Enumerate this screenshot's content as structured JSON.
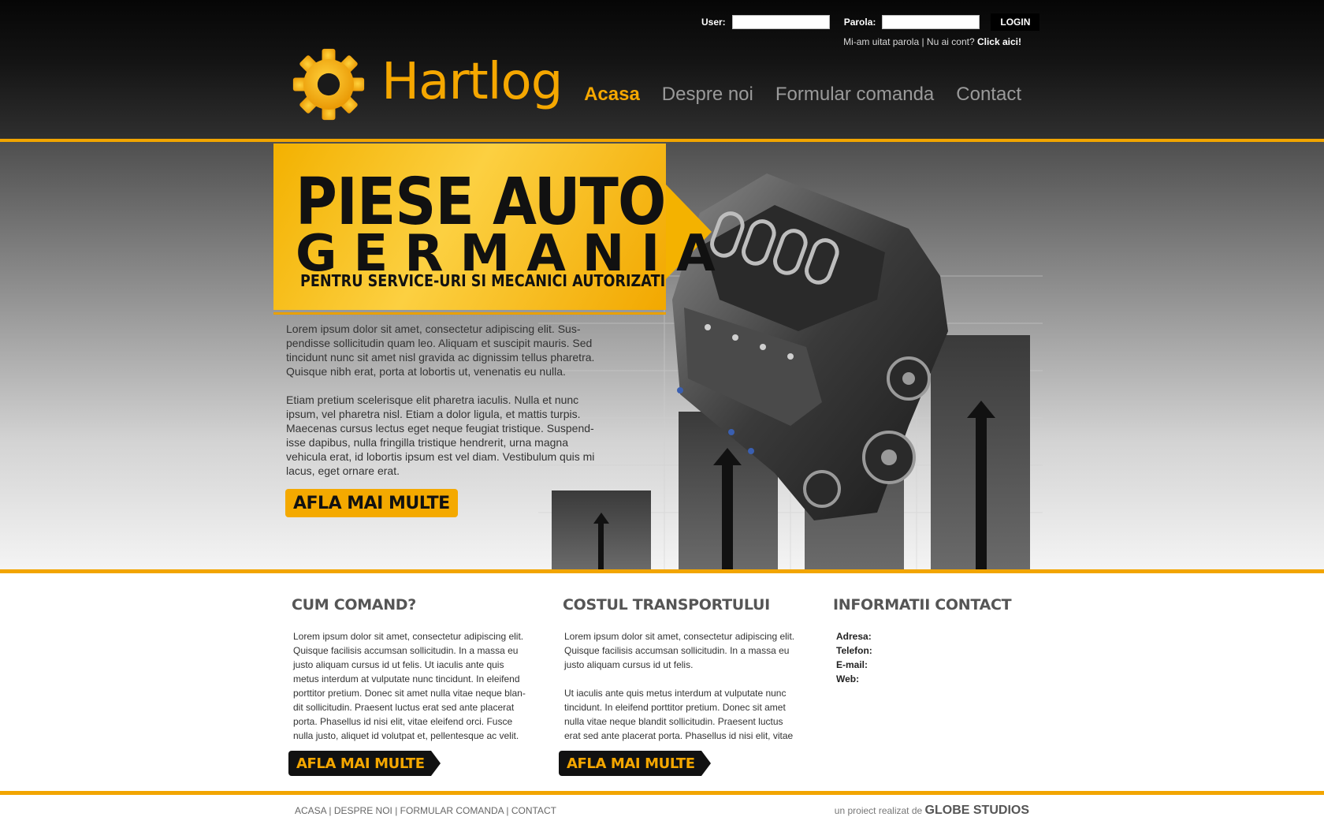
{
  "login": {
    "user_label": "User:",
    "user_value": "",
    "password_label": "Parola:",
    "password_value": "",
    "button_label": "LOGIN",
    "forgot_text": "Mi-am uitat parola",
    "separator": " | ",
    "no_account_text": "Nu ai cont?",
    "click_here": "Click aici!"
  },
  "brand": {
    "logo_text": "Hartlog",
    "accent_color": "#f5a700"
  },
  "nav": {
    "items": [
      {
        "label": "Acasa",
        "active": true
      },
      {
        "label": "Despre noi",
        "active": false
      },
      {
        "label": "Formular comanda",
        "active": false
      },
      {
        "label": "Contact",
        "active": false
      }
    ]
  },
  "hero": {
    "title": "PIESE AUTO",
    "subtitle": "GERMANIA",
    "tagline": "PENTRU SERVICE-URI SI MECANICI AUTORIZATI",
    "paragraphs": [
      "Lorem ipsum dolor sit amet, consectetur adipiscing elit. Sus- pendisse sollicitudin quam leo. Aliquam et suscipit mauris. Sed tincidunt nunc sit amet nisl gravida ac dignissim tellus pharetra. Quisque nibh erat, porta at lobortis ut, venenatis eu nulla.",
      "Etiam pretium scelerisque elit pharetra iaculis. Nulla et nunc ipsum, vel pharetra nisl. Etiam a dolor ligula, et mattis turpis. Maecenas cursus lectus eget neque feugiat tristique. Suspend- isse dapibus, nulla fringilla tristique hendrerit, urna magna vehicula erat, id lobortis ipsum est vel diam. Vestibulum quis mi lacus, eget ornare erat."
    ],
    "button_label": "AFLA MAI MULTE"
  },
  "columns": {
    "how_to_order": {
      "title": "CUM COMAND?",
      "paragraphs": [
        "Lorem ipsum dolor sit amet, consectetur adipiscing elit. Quisque facilisis accumsan sollicitudin. In a massa eu justo aliquam cursus id ut felis. Ut iaculis ante quis metus interdum at vulputate nunc tincidunt. In eleifend porttitor pretium. Donec sit amet nulla vitae neque blan- dit sollicitudin. Praesent luctus erat sed ante placerat porta. Phasellus id nisi elit, vitae eleifend orci. Fusce nulla justo, aliquet id volutpat et, pellentesque ac velit."
      ],
      "button_label": "AFLA MAI MULTE"
    },
    "shipping_cost": {
      "title": "COSTUL TRANSPORTULUI",
      "paragraphs": [
        "Lorem ipsum dolor sit amet, consectetur adipiscing elit. Quisque facilisis accumsan sollicitudin. In a massa eu justo aliquam cursus id ut felis.",
        "Ut iaculis ante quis metus interdum at vulputate nunc tincidunt. In eleifend porttitor pretium. Donec sit amet nulla vitae neque blandit sollicitudin. Praesent luctus erat sed ante placerat porta. Phasellus id nisi elit, vitae"
      ],
      "button_label": "AFLA MAI MULTE"
    },
    "contact_info": {
      "title": "INFORMATII CONTACT",
      "items": [
        "Adresa:",
        "Telefon:",
        "E-mail:",
        "Web:"
      ]
    }
  },
  "footer": {
    "links": [
      "ACASA",
      "DESPRE NOI",
      "FORMULAR COMANDA",
      "CONTACT"
    ],
    "credit_prefix": "un proiect realizat de",
    "credit_studio": "GLOBE STUDIOS"
  }
}
